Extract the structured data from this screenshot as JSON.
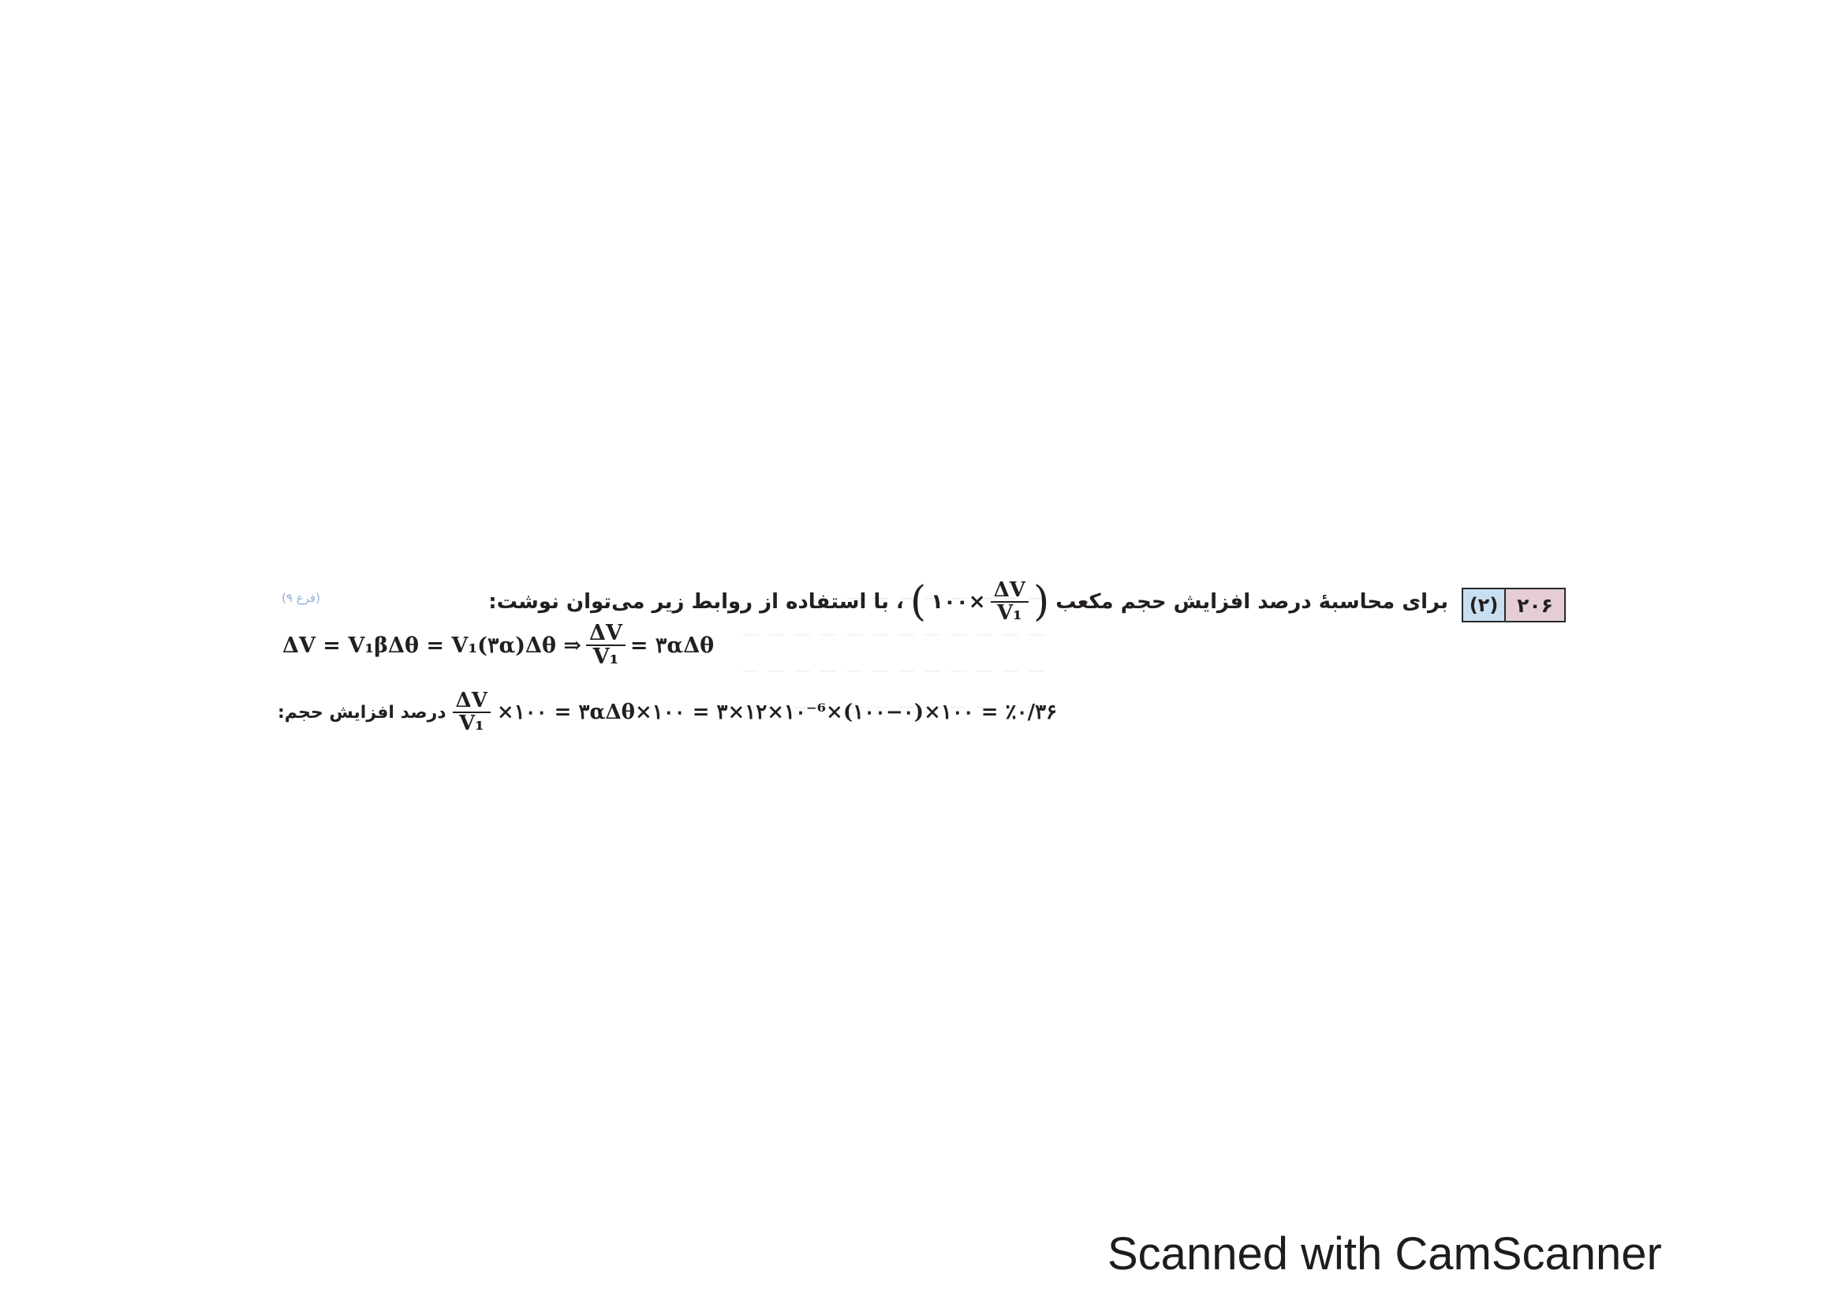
{
  "question": {
    "number": "۲۰۶",
    "answer": "(۲)",
    "text_before": "برای محاسبهٔ درصد افزایش حجم مکعب",
    "formula_factor": "۱۰۰×",
    "fraction_num": "ΔV",
    "fraction_den": "V₁",
    "text_after": "، با استفاده از روابط زیر می‌توان نوشت:",
    "reference_note": "(فرع ۹)"
  },
  "equation_1": {
    "lhs": "ΔV = V₁βΔθ = V₁(۳α)Δθ ⇒",
    "frac_num": "ΔV",
    "frac_den": "V₁",
    "rhs": "= ۳αΔθ"
  },
  "equation_2": {
    "label": "درصد افزایش حجم:",
    "frac_num": "ΔV",
    "frac_den": "V₁",
    "rest": "×۱۰۰ = ۳αΔθ×۱۰۰ = ۳×۱۲×۱۰⁻⁶×(۱۰۰−۰)×۱۰۰ = ٪۰/۳۶"
  },
  "footer": {
    "text": "Scanned with CamScanner"
  }
}
